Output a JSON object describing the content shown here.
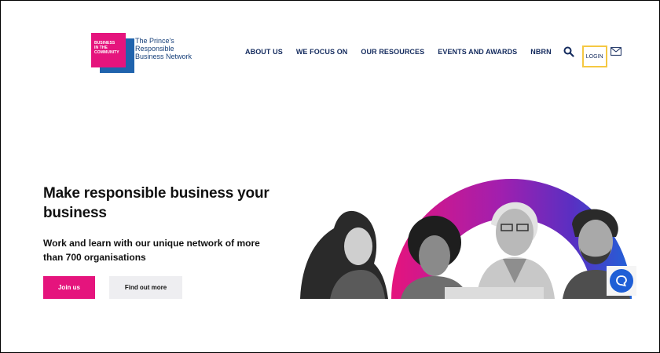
{
  "logo": {
    "square_lines": [
      "BUSINESS",
      "IN THE",
      "COMMUNITY"
    ],
    "name_lines": [
      "The Prince's",
      "Responsible",
      "Business Network"
    ]
  },
  "nav": {
    "items": [
      "ABOUT US",
      "WE FOCUS ON",
      "OUR RESOURCES",
      "EVENTS AND AWARDS",
      "NBRN"
    ],
    "login_label": "LOGIN"
  },
  "hero": {
    "title": "Make responsible business your business",
    "subtitle": "Work and learn with our unique network of more than 700 organisations",
    "join_label": "Join us",
    "more_label": "Find out more"
  },
  "icons": {
    "search": "search-icon",
    "mail": "mail-icon",
    "chat": "chat-icon"
  },
  "colors": {
    "brand_pink": "#e5147d",
    "brand_blue": "#1f63ad",
    "nav_text": "#142b5e",
    "login_border": "#f5c842",
    "chat_blue": "#1f5fd6"
  }
}
